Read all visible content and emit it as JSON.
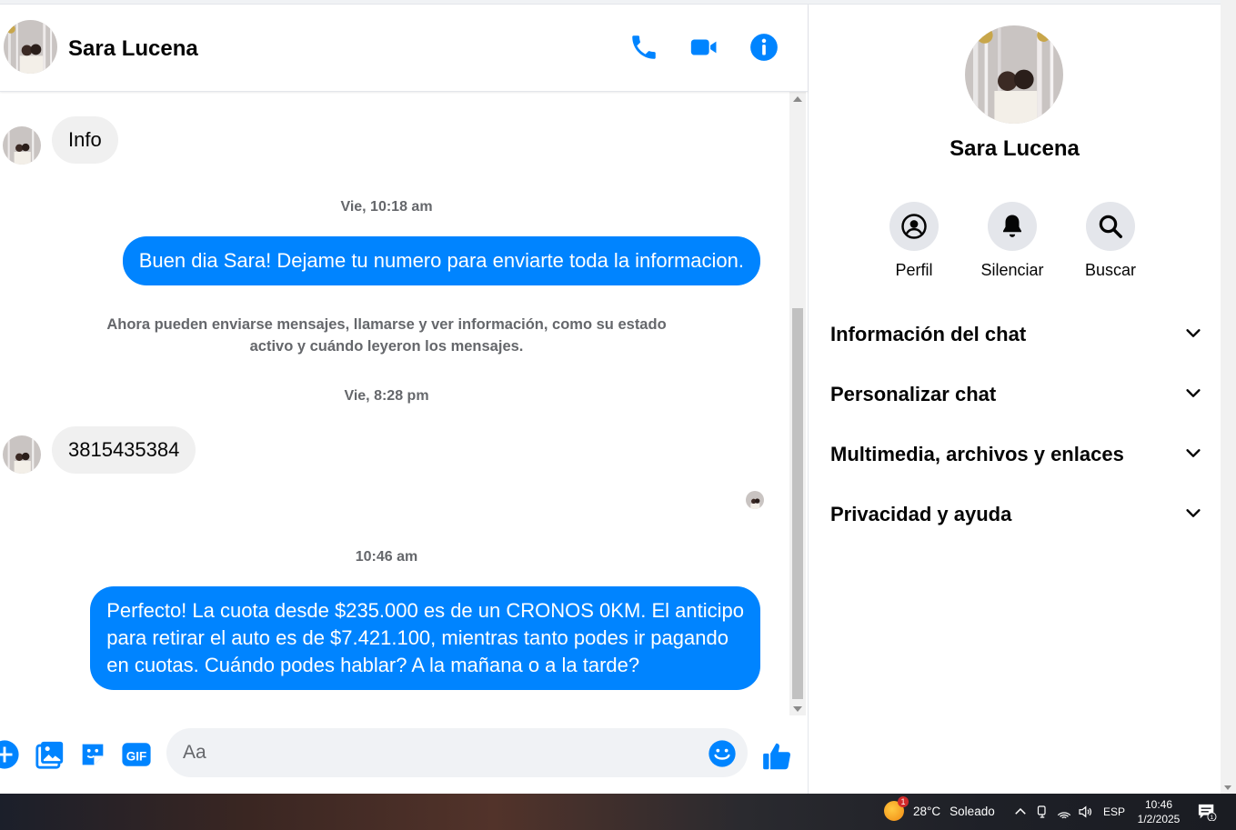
{
  "chat": {
    "contact_name": "Sara Lucena",
    "messages": {
      "info": "Info",
      "timestamp_1": "Vie, 10:18 am",
      "out_1": "Buen dia Sara! Dejame tu numero para enviarte toda la informacion.",
      "notice_line1": "Ahora pueden enviarse mensajes, llamarse y ver información, como su estado",
      "notice_line2": "activo y cuándo leyeron los mensajes.",
      "timestamp_2": "Vie, 8:28 pm",
      "phone": "3815435384",
      "timestamp_3": "10:46 am",
      "out_2_line1": "Perfecto! La cuota desde $235.000 es de un CRONOS 0KM. El anticipo",
      "out_2_line2": "para retirar el auto es de $7.421.100, mientras tanto podes ir pagando",
      "out_2_line3": "en cuotas. Cuándo podes hablar? A la mañana o a la tarde?"
    },
    "composer": {
      "placeholder": "Aa"
    }
  },
  "side_panel": {
    "name": "Sara Lucena",
    "actions": [
      {
        "label": "Perfil",
        "icon": "profile-icon"
      },
      {
        "label": "Silenciar",
        "icon": "bell-icon"
      },
      {
        "label": "Buscar",
        "icon": "search-icon"
      }
    ],
    "sections": [
      "Información del chat",
      "Personalizar chat",
      "Multimedia, archivos y enlaces",
      "Privacidad y ayuda"
    ]
  },
  "taskbar": {
    "temperature": "28°C",
    "weather": "Soleado",
    "weather_badge": "1",
    "language": "ESP",
    "time": "10:46",
    "date": "1/2/2025",
    "notification_count": "1"
  },
  "colors": {
    "messenger_blue": "#0084ff",
    "bubble_gray": "#f0f0f0",
    "secondary_text": "#65676b"
  }
}
